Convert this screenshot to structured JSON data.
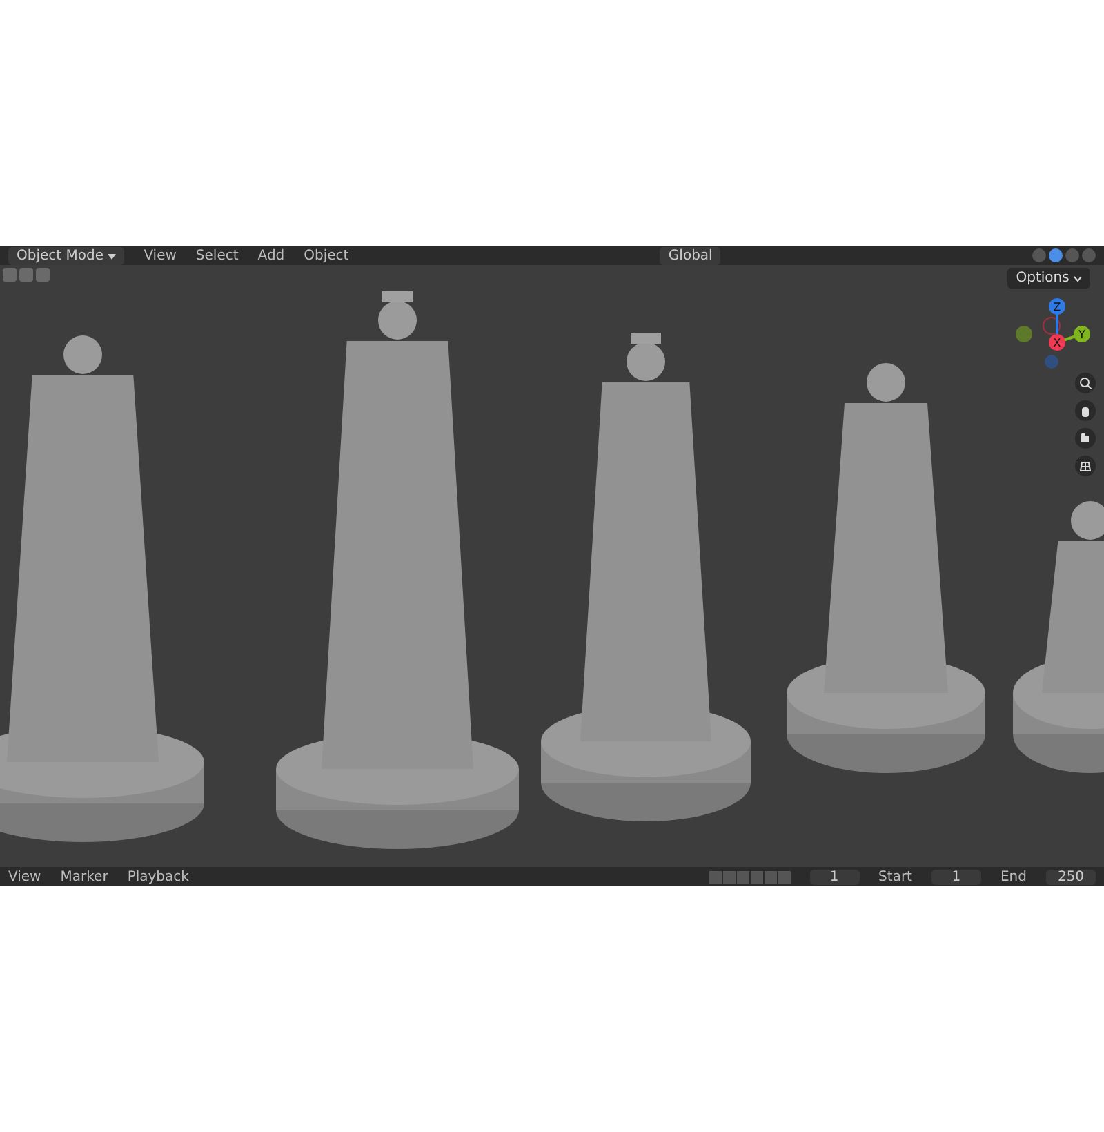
{
  "header": {
    "mode": "Object Mode",
    "menus": [
      "View",
      "Select",
      "Add",
      "Object"
    ],
    "orientation": "Global"
  },
  "viewport": {
    "options_button": "Options",
    "gizmo_axes": [
      {
        "label": "Z",
        "color": "#2f7ae5"
      },
      {
        "label": "Y",
        "color": "#7fb61f"
      },
      {
        "label": "X",
        "color": "#f03a54"
      }
    ]
  },
  "timeline": {
    "menus": [
      "View",
      "Marker",
      "Playback"
    ],
    "current_frame": "1",
    "start_label": "Start",
    "start": "1",
    "end_label": "End",
    "end": "250"
  }
}
